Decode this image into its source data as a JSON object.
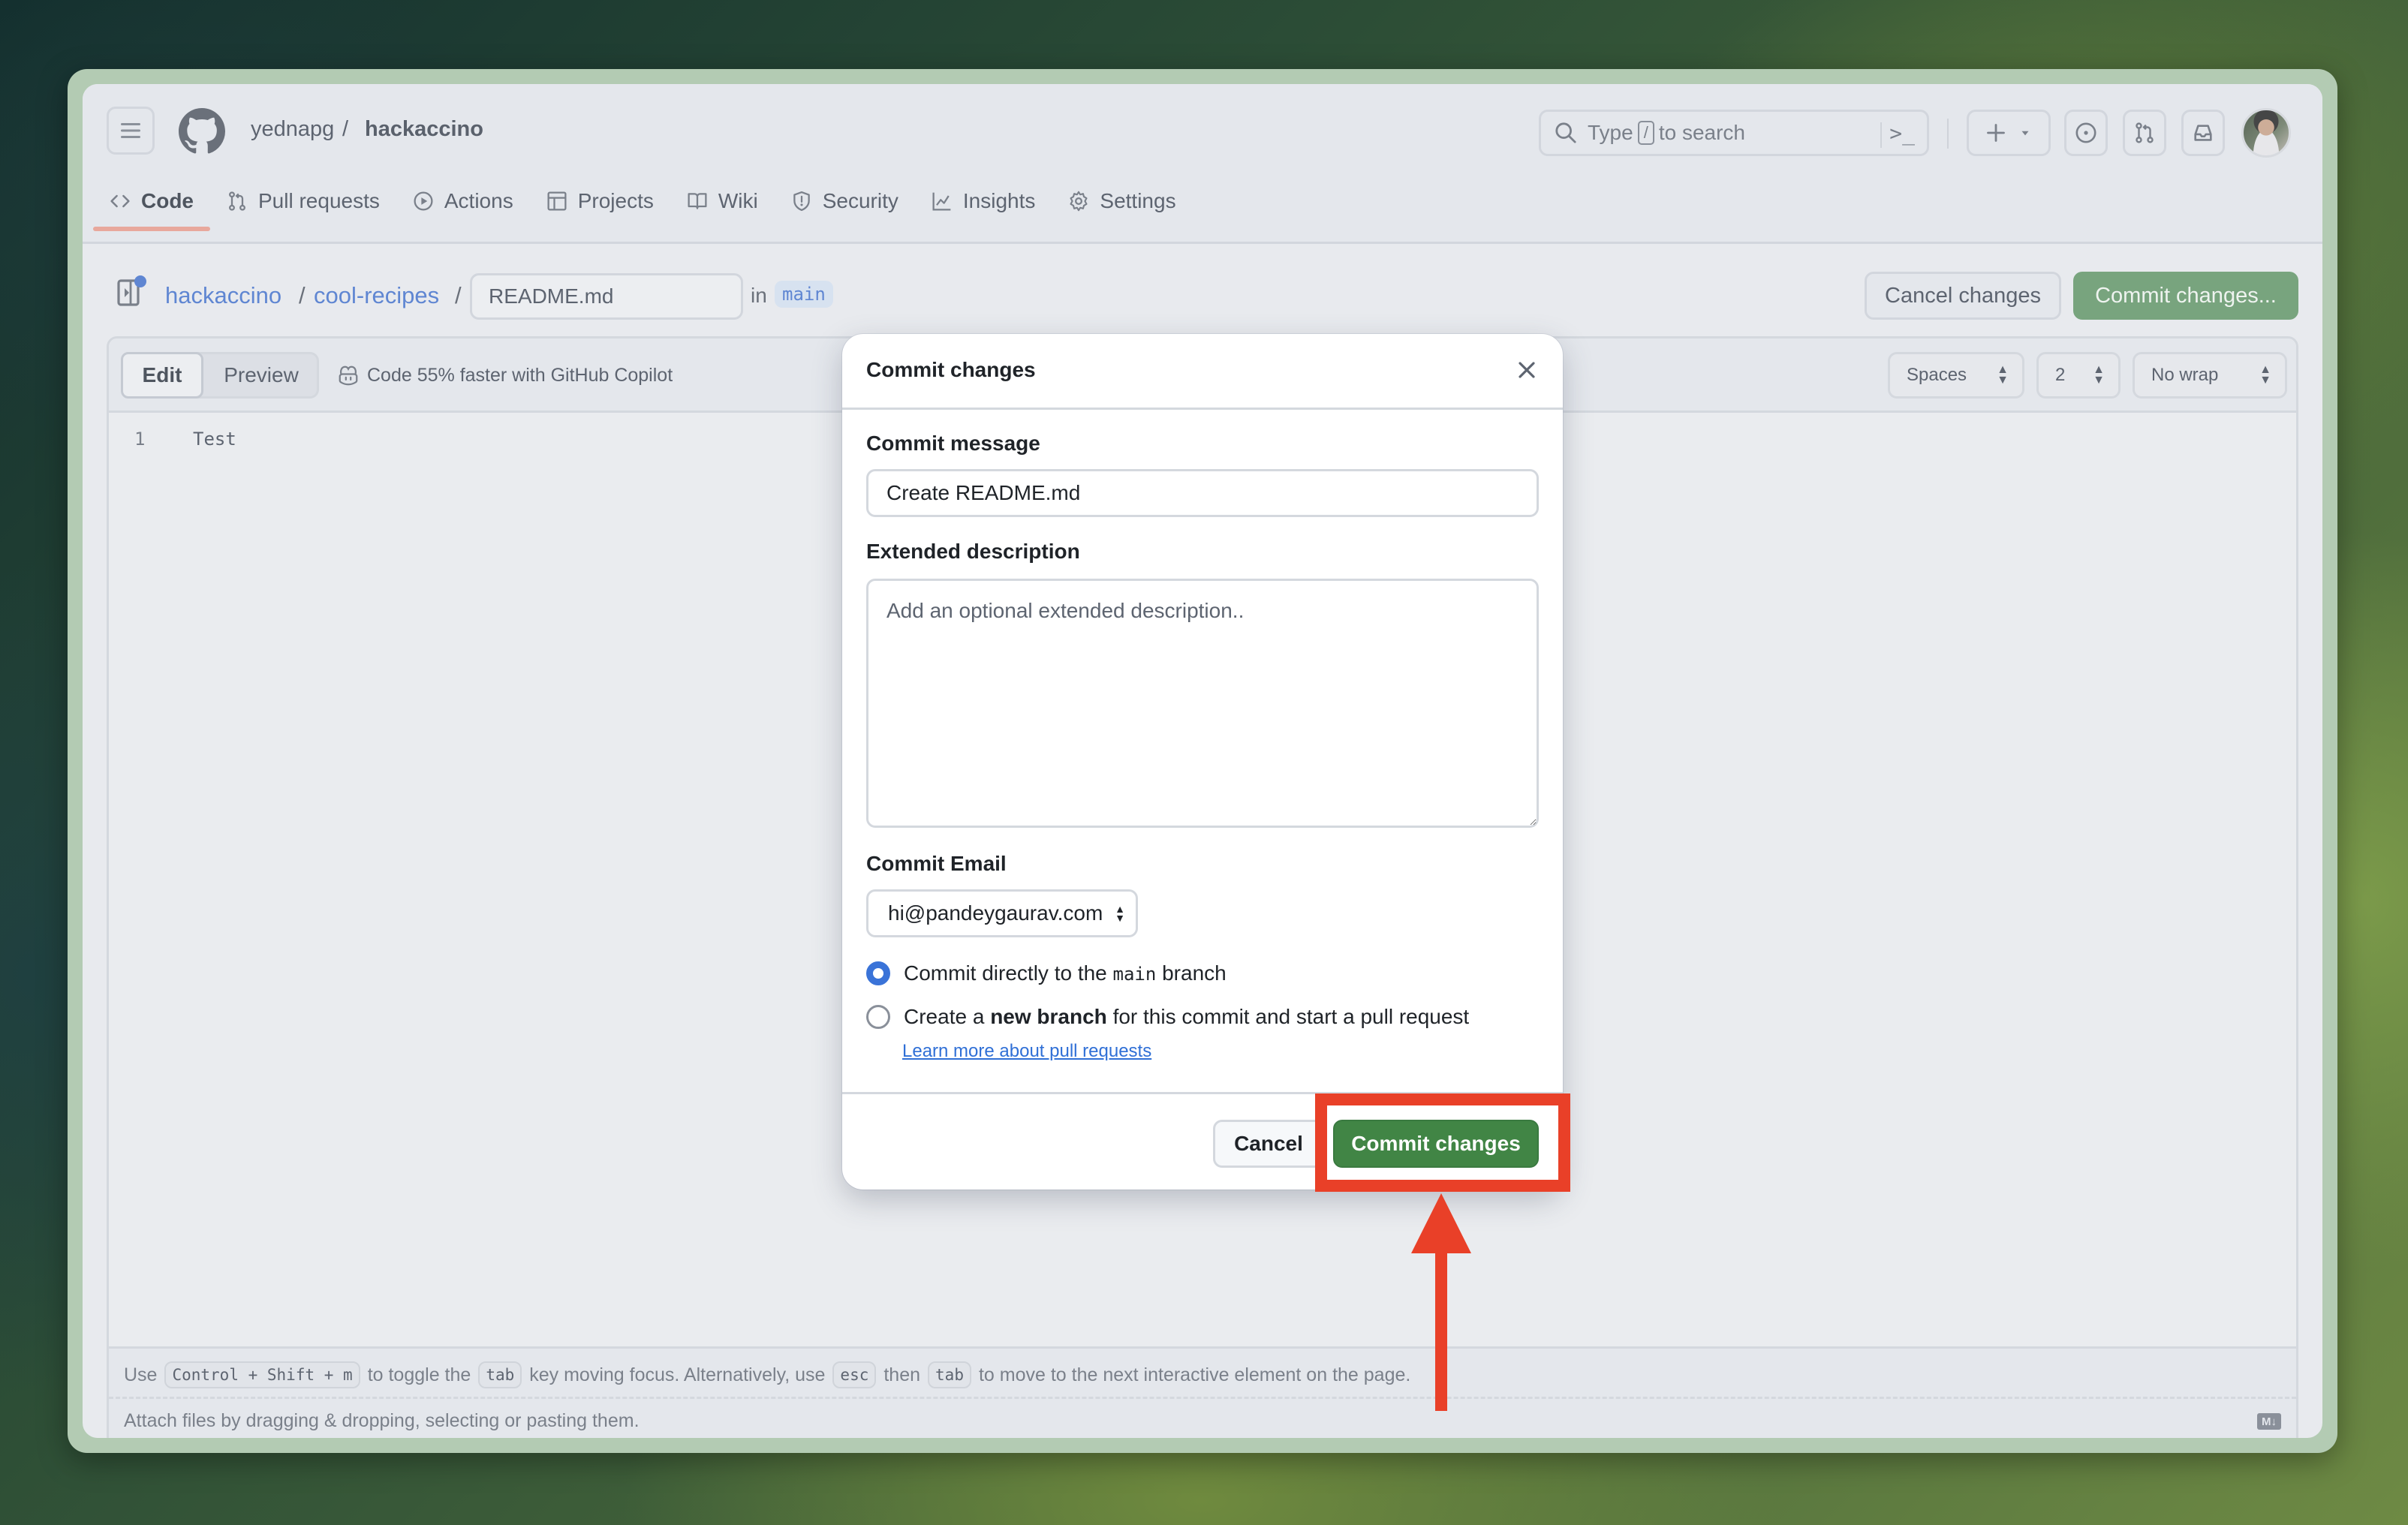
{
  "header": {
    "repo_owner": "yednapg",
    "repo_separator": "/",
    "repo_name": "hackaccino",
    "search_placeholder_prefix": "Type",
    "search_shortcut": "/",
    "search_placeholder_suffix": "to search",
    "command_palette_glyph": ">_",
    "avatar_alt": "User avatar"
  },
  "tabs": [
    {
      "label": "Code",
      "icon": "code-icon",
      "active": true
    },
    {
      "label": "Pull requests",
      "icon": "git-pull-request-icon"
    },
    {
      "label": "Actions",
      "icon": "play-icon"
    },
    {
      "label": "Projects",
      "icon": "table-icon"
    },
    {
      "label": "Wiki",
      "icon": "book-icon"
    },
    {
      "label": "Security",
      "icon": "shield-icon"
    },
    {
      "label": "Insights",
      "icon": "graph-icon"
    },
    {
      "label": "Settings",
      "icon": "gear-icon"
    }
  ],
  "breadcrumb": {
    "repo": "hackaccino",
    "sep1": "/",
    "folder": "cool-recipes",
    "sep2": "/",
    "filename": "README.md",
    "in_label": "in",
    "branch": "main"
  },
  "actions": {
    "cancel_changes": "Cancel changes",
    "commit_changes": "Commit changes..."
  },
  "editor": {
    "edit_tab": "Edit",
    "preview_tab": "Preview",
    "copilot_promo": "Code 55% faster with GitHub Copilot",
    "indent_mode": "Spaces",
    "indent_size": "2",
    "wrap_mode": "No wrap",
    "lines": [
      {
        "number": "1",
        "text": "Test"
      }
    ],
    "hint": {
      "use": "Use",
      "shortcut": "Control + Shift + m",
      "toggle_text": "to toggle the",
      "tab_key": "tab",
      "focus_text": "key moving focus. Alternatively, use",
      "esc_key": "esc",
      "then": "then",
      "tab_key2": "tab",
      "end_text": "to move to the next interactive element on the page."
    },
    "attach_text": "Attach files by dragging & dropping, selecting or pasting them.",
    "markdown_badge": "M↓"
  },
  "modal": {
    "title": "Commit changes",
    "commit_message_label": "Commit message",
    "commit_message_value": "Create README.md",
    "extended_label": "Extended description",
    "extended_placeholder": "Add an optional extended description..",
    "email_label": "Commit Email",
    "email_value": "hi@pandeygaurav.com",
    "option_direct_prefix": "Commit directly to the",
    "option_direct_branch": "main",
    "option_direct_suffix": "branch",
    "option_new_prefix": "Create a",
    "option_new_bold": "new branch",
    "option_new_suffix": "for this commit and start a pull request",
    "selected_option": "direct",
    "learn_more": "Learn more about pull requests",
    "cancel": "Cancel",
    "commit": "Commit changes"
  },
  "colors": {
    "primary_green": "#418545",
    "annotation_red": "#e94028",
    "link_blue": "#2f6fd6",
    "radio_blue": "#3a73d8"
  }
}
